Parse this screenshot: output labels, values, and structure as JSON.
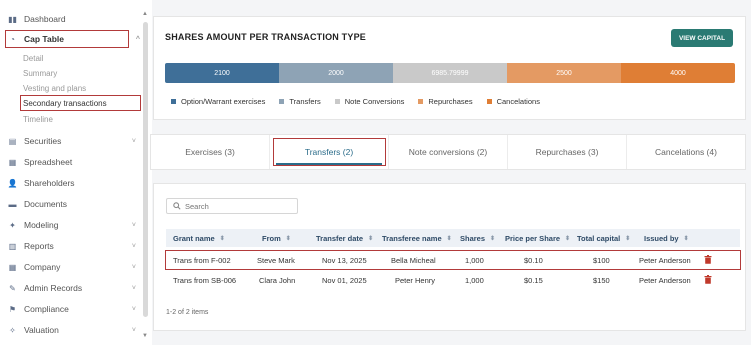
{
  "sidebar": {
    "items": [
      {
        "label": "Dashboard",
        "icon": "dashboard-icon",
        "glyph": "▮▮",
        "chevron": ""
      },
      {
        "label": "Cap Table",
        "icon": "pie-chart-icon",
        "glyph": "◔",
        "chevron": "^"
      },
      {
        "label": "Securities",
        "icon": "securities-icon",
        "glyph": "▤",
        "chevron": "˅"
      },
      {
        "label": "Spreadsheet",
        "icon": "spreadsheet-icon",
        "glyph": "▦",
        "chevron": ""
      },
      {
        "label": "Shareholders",
        "icon": "people-icon",
        "glyph": "👤",
        "chevron": ""
      },
      {
        "label": "Documents",
        "icon": "documents-icon",
        "glyph": "▬",
        "chevron": ""
      },
      {
        "label": "Modeling",
        "icon": "modeling-icon",
        "glyph": "✦",
        "chevron": "˅"
      },
      {
        "label": "Reports",
        "icon": "reports-icon",
        "glyph": "▥",
        "chevron": "˅"
      },
      {
        "label": "Company",
        "icon": "company-icon",
        "glyph": "▦",
        "chevron": "˅"
      },
      {
        "label": "Admin Records",
        "icon": "admin-records-icon",
        "glyph": "✎",
        "chevron": "˅"
      },
      {
        "label": "Compliance",
        "icon": "compliance-icon",
        "glyph": "⚑",
        "chevron": "˅"
      },
      {
        "label": "Valuation",
        "icon": "valuation-icon",
        "glyph": "✧",
        "chevron": "˅"
      }
    ],
    "subitems": [
      {
        "label": "Detail"
      },
      {
        "label": "Summary"
      },
      {
        "label": "Vesting and plans"
      },
      {
        "label": "Secondary transactions"
      },
      {
        "label": "Timeline"
      }
    ]
  },
  "chart_card": {
    "title": "SHARES AMOUNT PER TRANSACTION TYPE",
    "button": "VIEW CAPITAL"
  },
  "chart_data": {
    "type": "bar",
    "stacked": true,
    "orientation": "horizontal",
    "title": "SHARES AMOUNT PER TRANSACTION TYPE",
    "series": [
      {
        "name": "Option/Warrant exercises",
        "value": 2100,
        "label": "2100",
        "color": "#3f6f98"
      },
      {
        "name": "Transfers",
        "value": 2000,
        "label": "2000",
        "color": "#8ea3b5"
      },
      {
        "name": "Note Conversions",
        "value": 6985.79999,
        "label": "6985.79999",
        "color": "#c9c9c9"
      },
      {
        "name": "Repurchases",
        "value": 2500,
        "label": "2500",
        "color": "#e49a63"
      },
      {
        "name": "Cancelations",
        "value": 4000,
        "label": "4000",
        "color": "#df7e35"
      }
    ],
    "legend_position": "bottom"
  },
  "tabs": [
    {
      "label": "Exercises (3)"
    },
    {
      "label": "Transfers (2)"
    },
    {
      "label": "Note conversions (2)"
    },
    {
      "label": "Repurchases (3)"
    },
    {
      "label": "Cancelations (4)"
    }
  ],
  "table": {
    "search_placeholder": "Search",
    "columns": [
      "Grant name",
      "From",
      "Transfer date",
      "Transferee name",
      "Shares",
      "Price per Share",
      "Total capital",
      "Issued by"
    ],
    "rows": [
      [
        "Trans from F-002",
        "Steve Mark",
        "Nov 13, 2025",
        "Bella Micheal",
        "1,000",
        "$0.10",
        "$100",
        "Peter Anderson"
      ],
      [
        "Trans from SB-006",
        "Clara John",
        "Nov 01, 2025",
        "Peter Henry",
        "1,000",
        "$0.15",
        "$150",
        "Peter Anderson"
      ]
    ],
    "pagination": "1-2 of 2 items"
  }
}
